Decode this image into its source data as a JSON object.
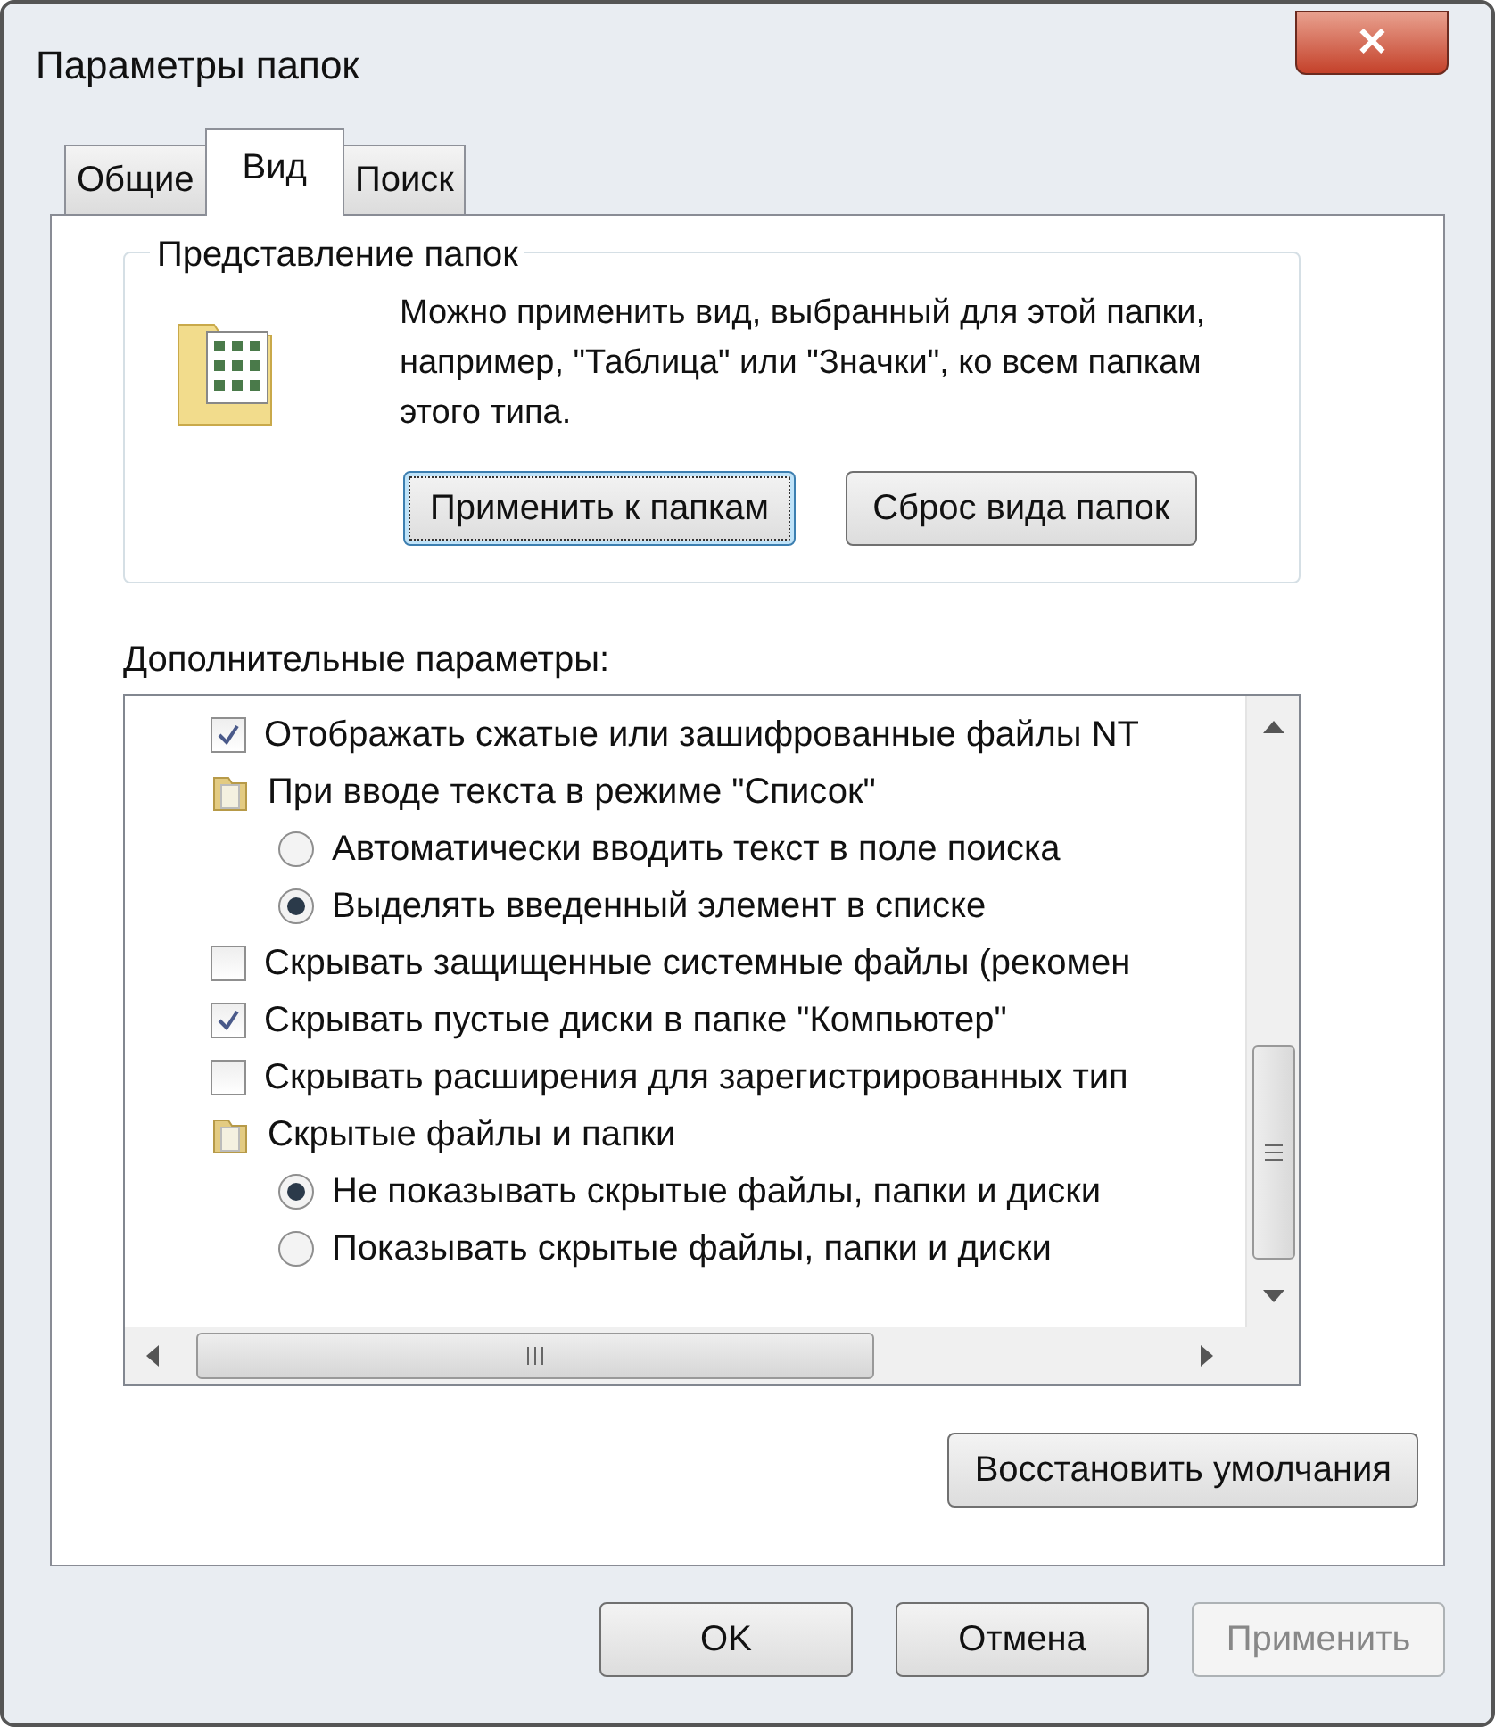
{
  "window": {
    "title": "Параметры папок",
    "close": "✕"
  },
  "tabs": [
    {
      "label": "Общие",
      "selected": false
    },
    {
      "label": "Вид",
      "selected": true
    },
    {
      "label": "Поиск",
      "selected": false
    }
  ],
  "folder_views": {
    "title": "Представление папок",
    "description": "Можно применить вид, выбранный для этой папки, например, \"Таблица\" или \"Значки\", ко всем папкам этого типа.",
    "buttons": [
      {
        "label": "Применить к папкам",
        "focused": true
      },
      {
        "label": "Сброс вида папок",
        "focused": false
      }
    ]
  },
  "advanced": {
    "label": "Дополнительные параметры:",
    "items": [
      {
        "kind": "checkbox",
        "label": "Отображать сжатые или зашифрованные файлы NT",
        "checked": true
      },
      {
        "kind": "group",
        "label": "При вводе текста в режиме \"Список\"",
        "children": [
          {
            "kind": "radio",
            "label": "Автоматически вводить текст в поле поиска",
            "selected": false
          },
          {
            "kind": "radio",
            "label": "Выделять введенный элемент в списке",
            "selected": true
          }
        ]
      },
      {
        "kind": "checkbox",
        "label": "Скрывать защищенные системные файлы (рекомен",
        "checked": false
      },
      {
        "kind": "checkbox",
        "label": "Скрывать пустые диски в папке \"Компьютер\"",
        "checked": true
      },
      {
        "kind": "checkbox",
        "label": "Скрывать расширения для зарегистрированных тип",
        "checked": false
      },
      {
        "kind": "group",
        "label": "Скрытые файлы и папки",
        "children": [
          {
            "kind": "radio",
            "label": "Не показывать скрытые файлы, папки и диски",
            "selected": true
          },
          {
            "kind": "radio",
            "label": "Показывать скрытые файлы, папки и диски",
            "selected": false
          }
        ]
      }
    ]
  },
  "restore_button": "Восстановить умолчания",
  "footer_buttons": [
    {
      "label": "OK",
      "disabled": false
    },
    {
      "label": "Отмена",
      "disabled": false
    },
    {
      "label": "Применить",
      "disabled": true
    }
  ]
}
